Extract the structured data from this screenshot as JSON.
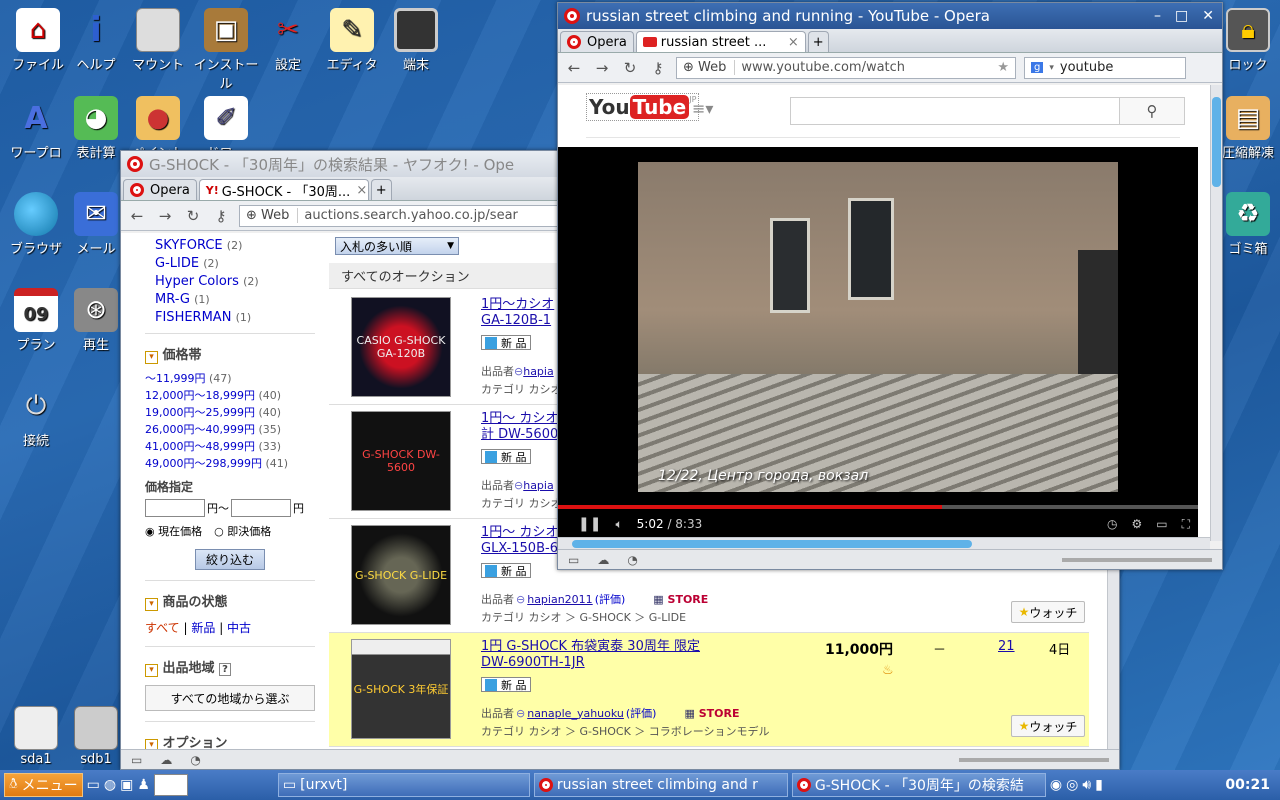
{
  "desktop": {
    "icons": [
      {
        "label": "ファイル"
      },
      {
        "label": "ヘルプ"
      },
      {
        "label": "マウント"
      },
      {
        "label": "インストール"
      },
      {
        "label": "設定"
      },
      {
        "label": "エディタ"
      },
      {
        "label": "端末"
      },
      {
        "label": "ワープロ"
      },
      {
        "label": "表計算"
      },
      {
        "label": "ペイント"
      },
      {
        "label": "ドロー"
      },
      {
        "label": "ブラウザ"
      },
      {
        "label": "メール"
      },
      {
        "label": "プラン"
      },
      {
        "label": "再生"
      },
      {
        "label": "接続"
      },
      {
        "label": "sda1"
      },
      {
        "label": "sdb1"
      },
      {
        "label": "ロック"
      },
      {
        "label": "圧縮解凍"
      },
      {
        "label": "ゴミ箱"
      }
    ],
    "calendar_day": "09",
    "calendar_month": "JANUARY"
  },
  "yahoo_window": {
    "title": "G-SHOCK - 「30周年」の検索結果 - ヤフオク! - Ope",
    "menu_tab": "Opera",
    "tab_label": "G-SHOCK - 「30周...",
    "addr_web": "Web",
    "url": "auctions.search.yahoo.co.jp/sear",
    "brands": [
      {
        "name": "SKYFORCE",
        "count": "(2)"
      },
      {
        "name": "G-LIDE",
        "count": "(2)"
      },
      {
        "name": "Hyper Colors",
        "count": "(2)"
      },
      {
        "name": "MR-G",
        "count": "(1)"
      },
      {
        "name": "FISHERMAN",
        "count": "(1)"
      }
    ],
    "price_heading": "価格帯",
    "prices": [
      {
        "range": "〜11,999円",
        "count": "(47)"
      },
      {
        "range": "12,000円〜18,999円",
        "count": "(40)"
      },
      {
        "range": "19,000円〜25,999円",
        "count": "(40)"
      },
      {
        "range": "26,000円〜40,999円",
        "count": "(35)"
      },
      {
        "range": "41,000円〜48,999円",
        "count": "(33)"
      },
      {
        "range": "49,000円〜298,999円",
        "count": "(41)"
      }
    ],
    "price_spec_label": "価格指定",
    "yen": "円",
    "yen_tilde": "円〜",
    "radio_current": "現在価格",
    "radio_buyout": "即決価格",
    "narrow_button": "絞り込む",
    "condition_heading": "商品の状態",
    "cond_all": "すべて",
    "cond_new": "新品",
    "cond_used": "中古",
    "region_heading": "出品地域",
    "region_button": "すべての地域から選ぶ",
    "option_heading": "オプション",
    "sort_select": "入札の多い順",
    "all_auctions": "すべてのオークション",
    "new_badge": "新 品",
    "seller_label": "出品者",
    "rating_label": "(評価)",
    "store_label": "STORE",
    "watch_label": "ウォッチ",
    "items": [
      {
        "title1": "1円〜カシオ",
        "title2": "GA-120B-1",
        "seller": "hapia",
        "cat": "カテゴリ カシオ",
        "thumb": "CASIO G-SHOCK GA-120B"
      },
      {
        "title1": "1円〜 カシオ",
        "title2": "計 DW-5600",
        "seller": "hapia",
        "cat": "カテゴリ カシオ",
        "thumb": "G-SHOCK DW-5600"
      },
      {
        "title1": "1円〜 カシオ",
        "title2": "GLX-150B-6",
        "seller": "hapian2011",
        "cat": "カテゴリ カシオ ＞ G-SHOCK ＞ G-LIDE",
        "thumb": "G-SHOCK G-LIDE"
      },
      {
        "title1": "1円 G-SHOCK 布袋寅泰 30周年 限定",
        "title2": "DW-6900TH-1JR",
        "seller": "nanaple_yahuoku",
        "cat": "カテゴリ カシオ ＞ G-SHOCK ＞ コラボレーションモデル",
        "price": "11,000円",
        "buyout": "－",
        "bids": "21",
        "remaining": "4日",
        "thumb": "G-SHOCK 3年保証"
      }
    ]
  },
  "youtube_window": {
    "title": "russian street climbing and running - YouTube - Opera",
    "menu_tab": "Opera",
    "tab_label": "russian street ...",
    "addr_web": "Web",
    "url": "www.youtube.com/watch",
    "search_value": "youtube",
    "logo_you": "You",
    "logo_tube": "Tube",
    "logo_jp": "JP",
    "video_caption": "12/22, Центр города, вокзал",
    "time_current": "5:02",
    "time_sep": " / ",
    "time_total": "8:33",
    "progress_fraction": 0.6
  },
  "taskbar": {
    "menu_label": "メニュー",
    "tasks": [
      {
        "label": "[urxvt]"
      },
      {
        "label": "russian street climbing and r"
      },
      {
        "label": "G-SHOCK - 「30周年」の検索結"
      }
    ],
    "clock": "00:21"
  }
}
